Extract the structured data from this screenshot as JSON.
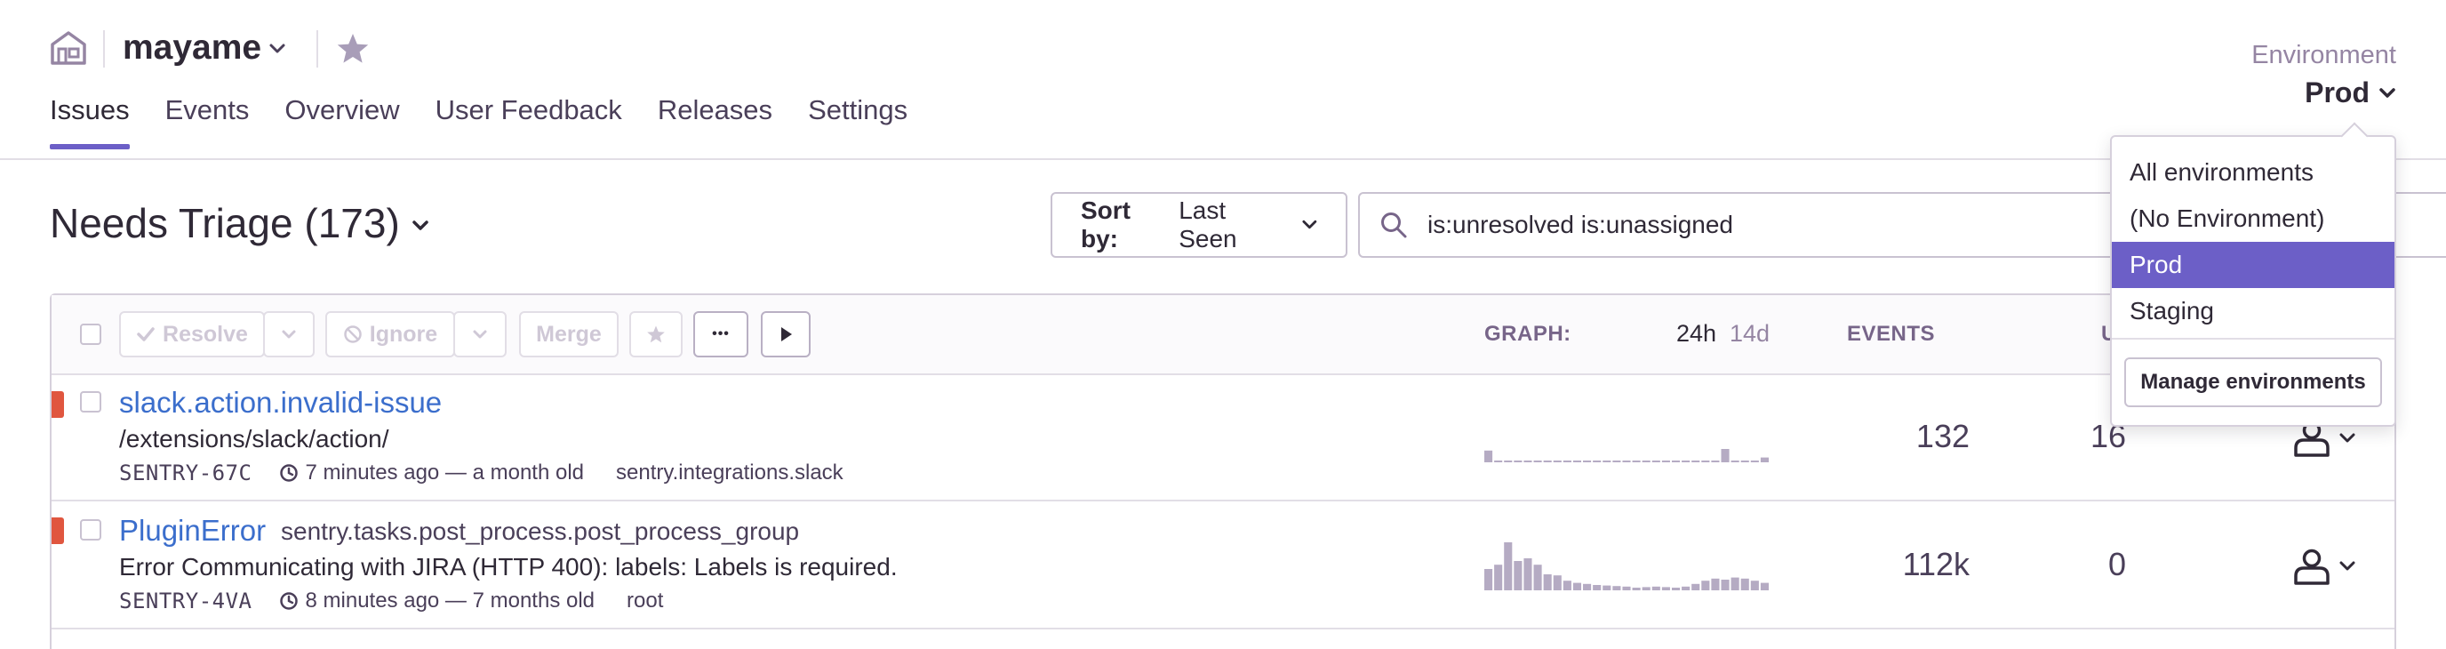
{
  "header": {
    "project_name": "mayame",
    "tabs": [
      {
        "label": "Issues",
        "active": true
      },
      {
        "label": "Events",
        "active": false
      },
      {
        "label": "Overview",
        "active": false
      },
      {
        "label": "User Feedback",
        "active": false
      },
      {
        "label": "Releases",
        "active": false
      },
      {
        "label": "Settings",
        "active": false
      }
    ],
    "environment": {
      "label": "Environment",
      "selected": "Prod"
    }
  },
  "toolbar": {
    "title": "Needs Triage (173)",
    "sort_label": "Sort by:",
    "sort_value": "Last Seen",
    "search_query": "is:unresolved is:unassigned"
  },
  "list_actions": {
    "resolve": "Resolve",
    "ignore": "Ignore",
    "merge": "Merge",
    "more": "•••"
  },
  "columns": {
    "graph": "GRAPH:",
    "period_active": "24h",
    "period_inactive": "14d",
    "events": "EVENTS",
    "users_partial": "U"
  },
  "issues": [
    {
      "title": "slack.action.invalid-issue",
      "culprit": "",
      "message": "/extensions/slack/action/",
      "short_id": "SENTRY-67C",
      "time": "7 minutes ago — a month old",
      "logger": "sentry.integrations.slack",
      "events": "132",
      "users": "16",
      "sparkline": [
        0.22,
        0.03,
        0.03,
        0.03,
        0.03,
        0.03,
        0.03,
        0.03,
        0.03,
        0.03,
        0.03,
        0.03,
        0.03,
        0.03,
        0.03,
        0.03,
        0.03,
        0.03,
        0.03,
        0.03,
        0.03,
        0.03,
        0.03,
        0.03,
        0.25,
        0.03,
        0.03,
        0.03,
        0.09
      ]
    },
    {
      "title": "PluginError",
      "culprit": "sentry.tasks.post_process.post_process_group",
      "message": "Error Communicating with JIRA (HTTP 400): labels: Labels is required.",
      "short_id": "SENTRY-4VA",
      "time": "8 minutes ago — 7 months old",
      "logger": "root",
      "events": "112k",
      "users": "0",
      "sparkline": [
        0.4,
        0.48,
        0.9,
        0.55,
        0.6,
        0.48,
        0.3,
        0.28,
        0.18,
        0.14,
        0.12,
        0.1,
        0.09,
        0.08,
        0.07,
        0.05,
        0.06,
        0.07,
        0.06,
        0.05,
        0.07,
        0.12,
        0.18,
        0.22,
        0.2,
        0.24,
        0.22,
        0.18,
        0.14
      ]
    }
  ],
  "env_menu": {
    "items": [
      {
        "label": "All environments",
        "selected": false
      },
      {
        "label": "(No Environment)",
        "selected": false
      },
      {
        "label": "Prod",
        "selected": true
      },
      {
        "label": "Staging",
        "selected": false
      }
    ],
    "manage_label": "Manage environments"
  },
  "colors": {
    "accent": "#6c5fc7",
    "link": "#3b6ecc",
    "error_level": "#e0563f",
    "sparkline": "#b5abc3"
  },
  "icons": [
    "home-icon",
    "chevron-down-icon",
    "star-icon",
    "search-icon",
    "checkmark-icon",
    "ignore-icon",
    "play-icon",
    "clock-icon",
    "user-icon"
  ]
}
